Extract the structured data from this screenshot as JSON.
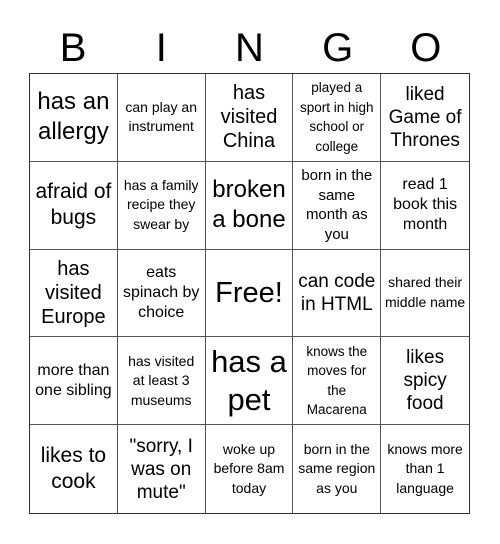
{
  "title": {
    "letters": [
      "B",
      "I",
      "N",
      "G",
      "O"
    ]
  },
  "card": {
    "cells": [
      "has an allergy",
      "can play an instrument",
      "has visited China",
      "played a sport in high school or college",
      "liked Game of Thrones",
      "afraid of bugs",
      "has a family recipe they swear by",
      "broken a bone",
      "born in the same month as you",
      "read 1 book this month",
      "has visited Europe",
      "eats spinach by choice",
      "Free!",
      "can code in HTML",
      "shared their middle name",
      "more than one sibling",
      "has visited at least 3 museums",
      "has a pet",
      "knows the moves for the Macarena",
      "likes spicy food",
      "likes to cook",
      "\"sorry, I was on mute\"",
      "woke up before 8am today",
      "born in the same region as you",
      "knows more than 1 language"
    ],
    "free_space_index": 12
  }
}
